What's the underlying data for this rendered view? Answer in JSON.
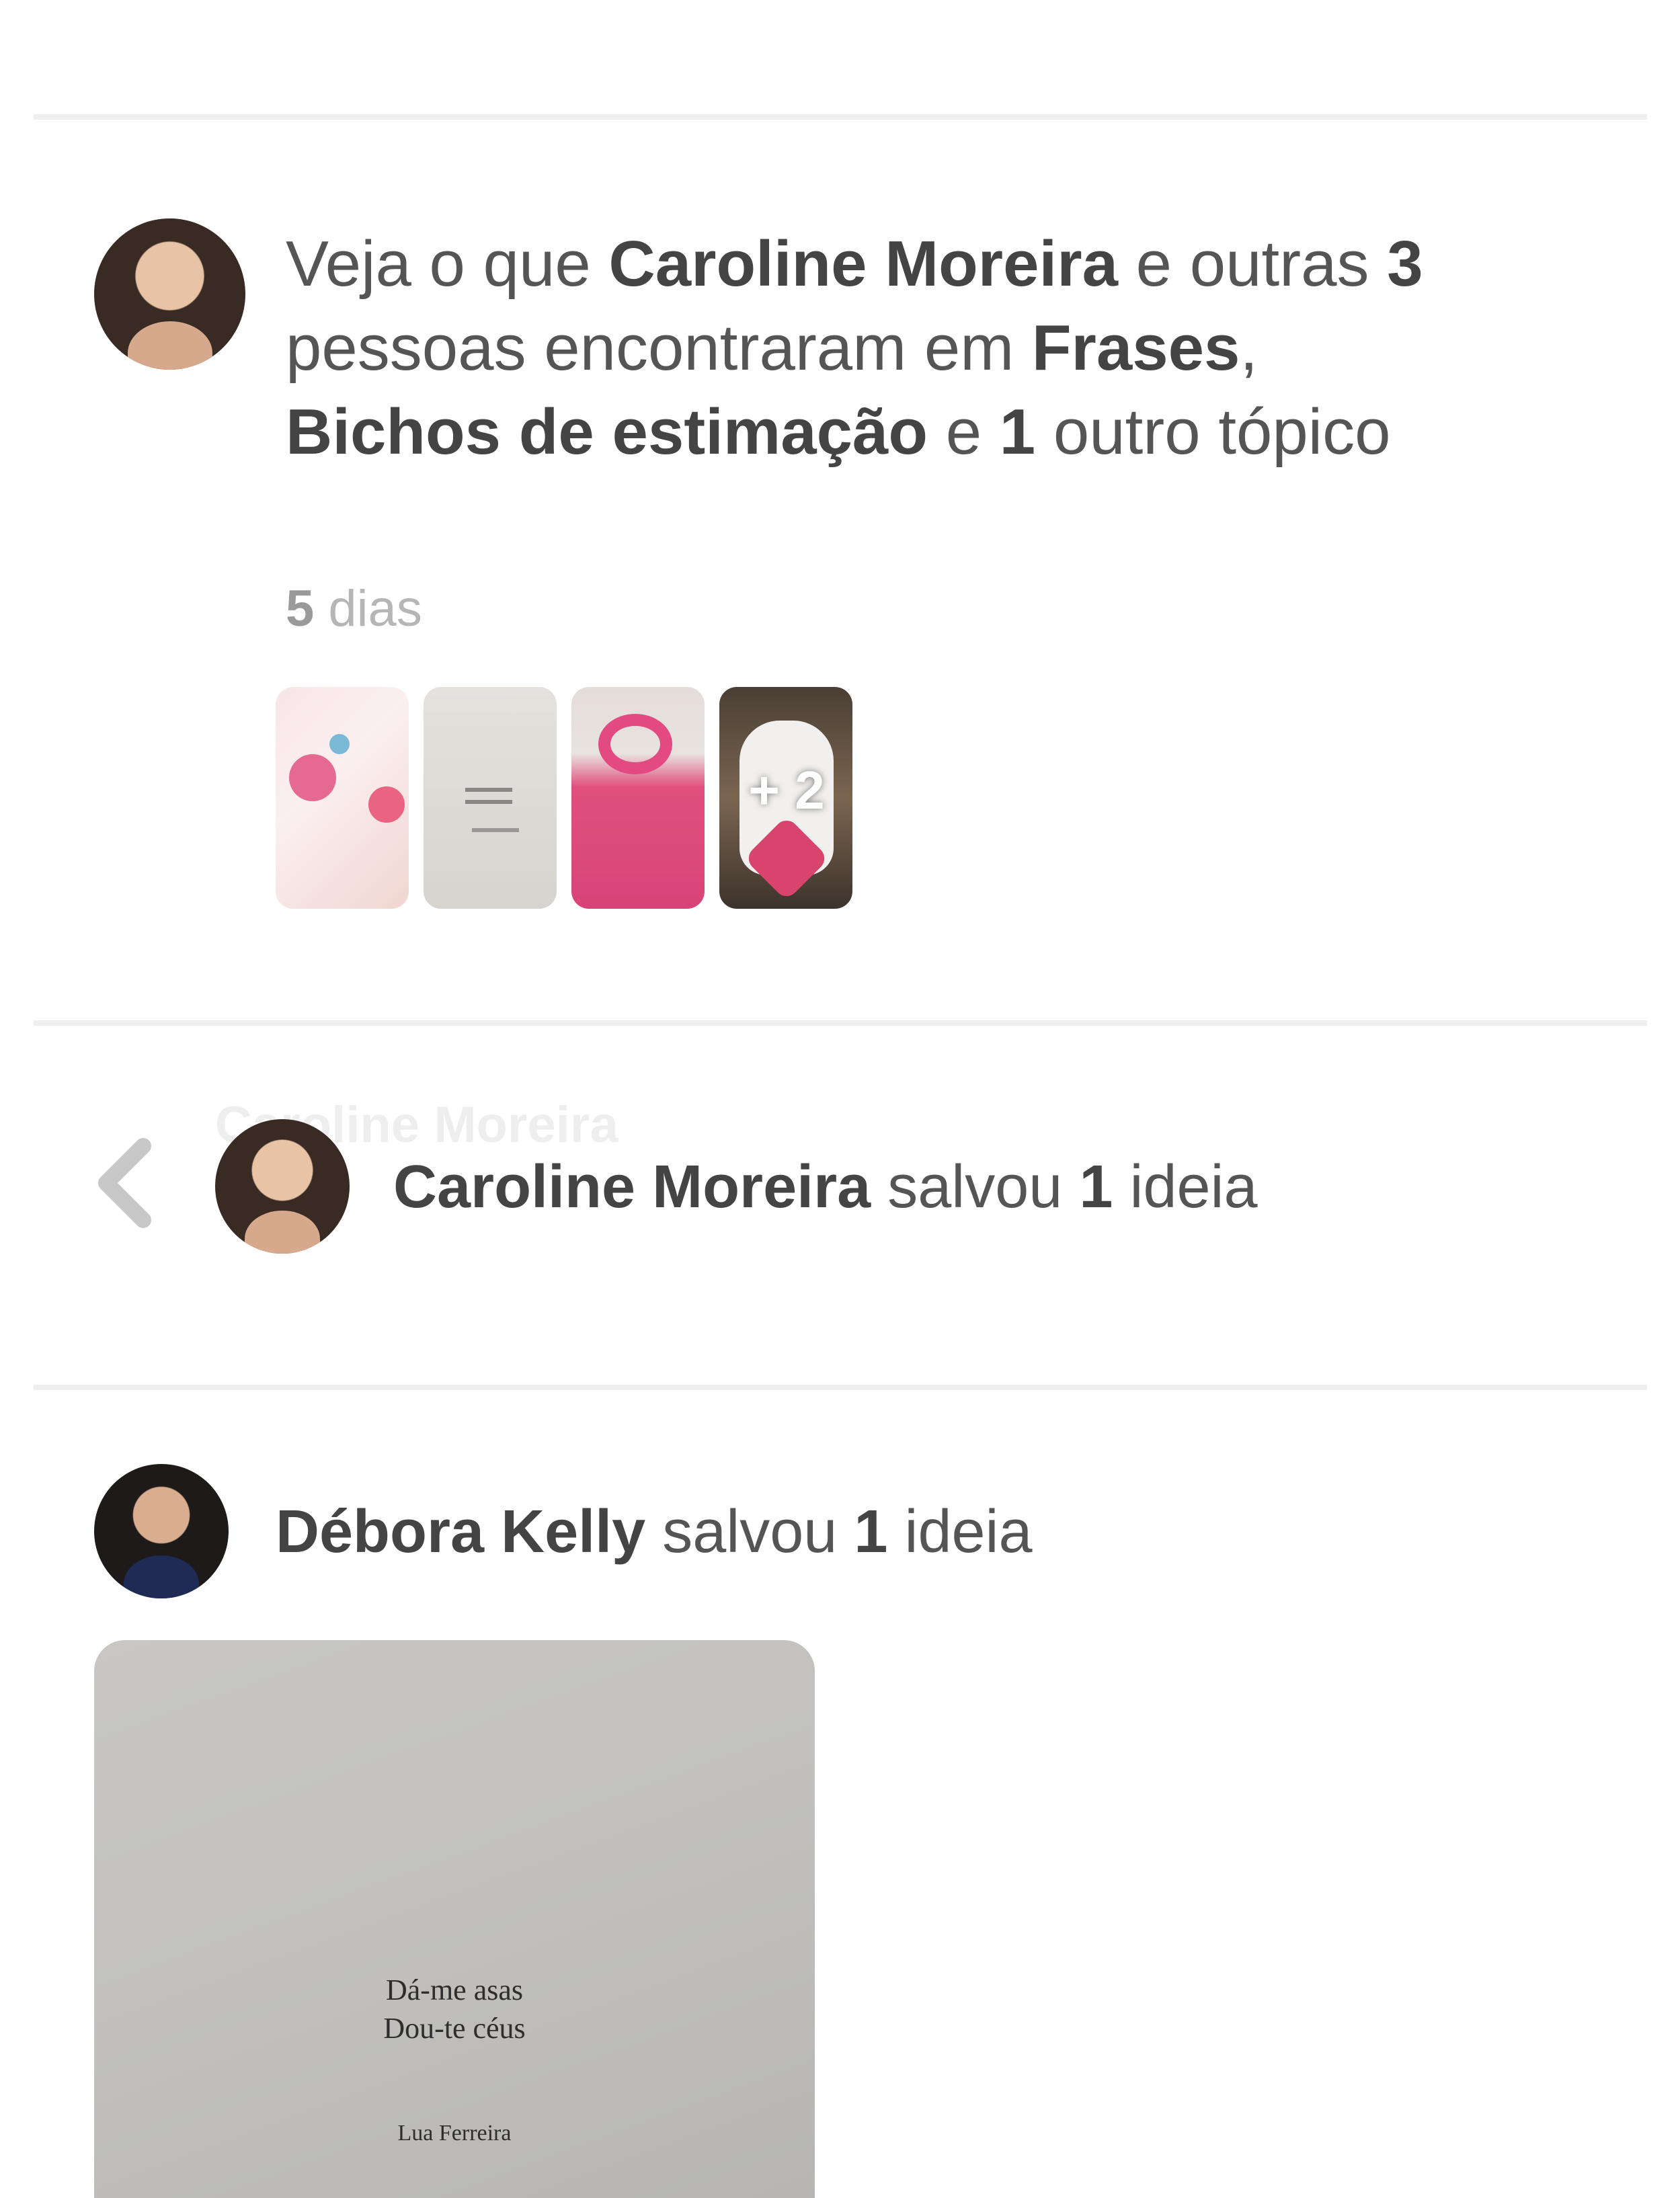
{
  "story_1": {
    "prefix": "Veja o que ",
    "user": "Caroline Moreira",
    "mid1": " e outras ",
    "others_count": "3",
    "mid2": " pessoas encontraram em ",
    "topic_1": "Frases",
    "comma": ", ",
    "topic_2": "Bichos de estimação",
    "mid3": " e ",
    "extra_topics": "1",
    "suffix": " outro tópico",
    "time_number": "5",
    "time_unit": " dias",
    "more_pins": "+ 2",
    "thumbnails": [
      "card-floral",
      "card-text",
      "pink-crochet",
      "white-dog"
    ]
  },
  "story_2": {
    "ghost_text": "Caroline Moreira",
    "user": "Caroline Moreira",
    "action": " salvou ",
    "count": "1",
    "noun": " ideia"
  },
  "story_3": {
    "user": "Débora Kelly",
    "action": " salvou ",
    "count": "1",
    "noun": " ideia",
    "pin_text_line1": "Dá-me asas",
    "pin_text_line2": "Dou-te céus",
    "pin_author": "Lua Ferreira"
  },
  "colors": {
    "divider": "#eeeeee",
    "text": "#555555",
    "muted": "#b6b6b6"
  },
  "icons": [
    "chevron-left-icon"
  ]
}
